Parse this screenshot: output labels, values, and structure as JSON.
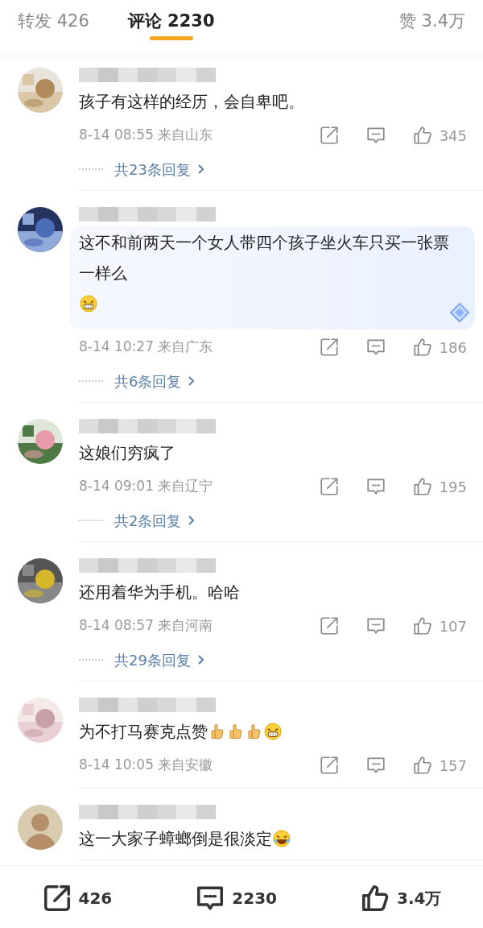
{
  "tabs": [
    {
      "label": "转发 426",
      "selected": false
    },
    {
      "label": "评论 2230",
      "selected": true
    },
    {
      "label": "赞 3.4万",
      "selected": false
    }
  ],
  "comments": [
    {
      "text": "孩子有这样的经历，会自卑吧。",
      "highlight": false,
      "time": "8-14 08:55",
      "location": "来自山东",
      "likes": "345",
      "replies": "共23条回复"
    },
    {
      "text": "这不和前两天一个女人带四个孩子坐火车只买一张票一样么",
      "emoji": [
        {
          "kind": "grin"
        }
      ],
      "highlight": true,
      "time": "8-14 10:27",
      "location": "来自广东",
      "likes": "186",
      "replies": "共6条回复"
    },
    {
      "text": "这娘们穷疯了",
      "highlight": false,
      "time": "8-14 09:01",
      "location": "来自辽宁",
      "likes": "195",
      "replies": "共2条回复"
    },
    {
      "text": "还用着华为手机。哈哈",
      "highlight": false,
      "time": "8-14 08:57",
      "location": "来自河南",
      "likes": "107",
      "replies": "共29条回复"
    },
    {
      "text": "为不打马赛克点赞",
      "emoji": [
        {
          "kind": "thumb"
        },
        {
          "kind": "thumb"
        },
        {
          "kind": "thumb"
        },
        {
          "kind": "grin"
        }
      ],
      "highlight": false,
      "time": "8-14 10:05",
      "location": "来自安徽",
      "likes": "157"
    },
    {
      "text": "这一大家子蟑螂倒是很淡定",
      "emoji": [
        {
          "kind": "laugh"
        }
      ],
      "highlight": false
    }
  ],
  "bottom_bar": {
    "reposts": "426",
    "comments": "2230",
    "likes": "3.4万"
  }
}
